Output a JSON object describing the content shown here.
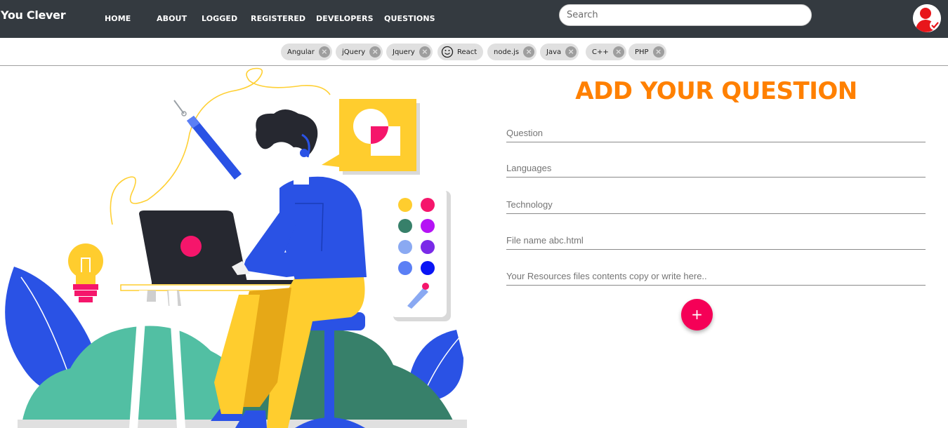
{
  "navbar": {
    "brand": "You Clever",
    "links": [
      {
        "label": "HOME"
      },
      {
        "label": "ABOUT"
      },
      {
        "label": "LOGGED"
      },
      {
        "label": "REGISTERED"
      },
      {
        "label": "DEVELOPERS"
      },
      {
        "label": "QUESTIONS"
      }
    ],
    "search_placeholder": "Search",
    "avatar_icon": "user-avatar-icon"
  },
  "tags": [
    {
      "label": "Angular"
    },
    {
      "label": "jQuery"
    },
    {
      "label": "Jquery"
    },
    {
      "label": "React",
      "icon": "smiley-icon"
    },
    {
      "label": "node.js"
    },
    {
      "label": "Java"
    },
    {
      "label": "C++"
    },
    {
      "label": "PHP"
    }
  ],
  "form": {
    "title": "ADD YOUR QUESTION",
    "fields": [
      {
        "placeholder": "Question"
      },
      {
        "placeholder": "Languages"
      },
      {
        "placeholder": "Technology"
      },
      {
        "placeholder": "File name abc.html"
      },
      {
        "placeholder": "Your Resources files contents copy or write here.."
      }
    ],
    "add_button_label": "+"
  },
  "colors": {
    "navbar_bg": "#343a40",
    "title": "#ff8000",
    "fab": "#f50057",
    "chip_bg": "#e0e0e0"
  }
}
